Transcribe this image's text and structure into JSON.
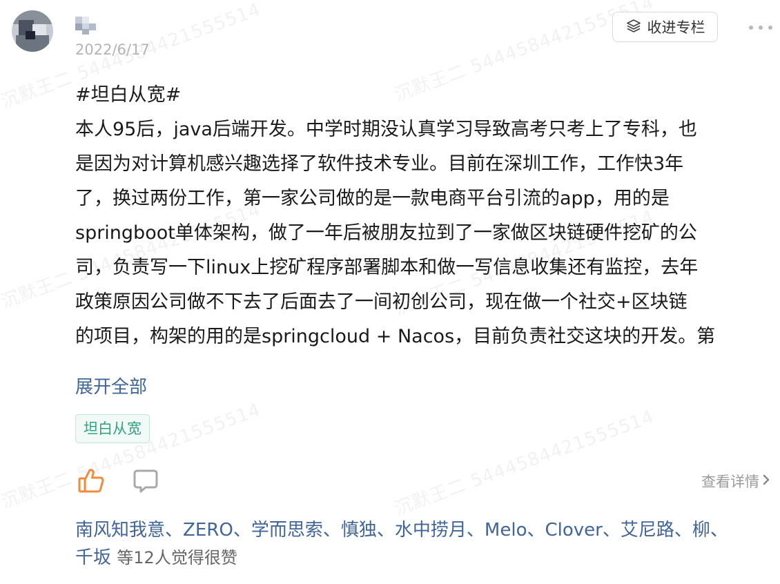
{
  "post": {
    "date": "2022/6/17",
    "collect_label": "收进专栏",
    "content_lines": [
      "#坦白从宽#",
      "本人95后，java后端开发。中学时期没认真学习导致高考只考上了专科，也",
      "是因为对计算机感兴趣选择了软件技术专业。目前在深圳工作，工作快3年",
      "了，换过两份工作，第一家公司做的是一款电商平台引流的app，用的是",
      "springboot单体架构，做了一年后被朋友拉到了一家做区块链硬件挖矿的公",
      "司，负责写一下linux上挖矿程序部署脚本和做一写信息收集还有监控，去年",
      "政策原因公司做不下去了后面去了一间初创公司，现在做一个社交+区块链",
      "的项目，构架的用的是springcloud + Nacos，目前负责社交这块的开发。第"
    ],
    "expand_label": "展开全部",
    "tag": "坦白从宽",
    "details_label": "查看详情",
    "likers": [
      "南风知我意",
      "ZERO",
      "学而思索",
      "慎独",
      "水中捞月",
      "Melo",
      "Clover",
      "艾尼路",
      "柳",
      "千坂"
    ],
    "likers_separator": "、",
    "likes_suffix": "等12人觉得很赞"
  },
  "watermark": {
    "text": "沉默王二 5444584421555514"
  },
  "icons": {
    "collect": "stack-layers-icon",
    "more": "more-dots-icon",
    "like": "thumbs-up-icon",
    "comment": "comment-bubble-icon",
    "details": "chevron-right-icon"
  },
  "colors": {
    "link": "#406599",
    "like_icon": "#f38a3a",
    "tag_text": "#2fa37f",
    "tag_bg": "#f2faf7",
    "muted": "#9a9a9a"
  }
}
